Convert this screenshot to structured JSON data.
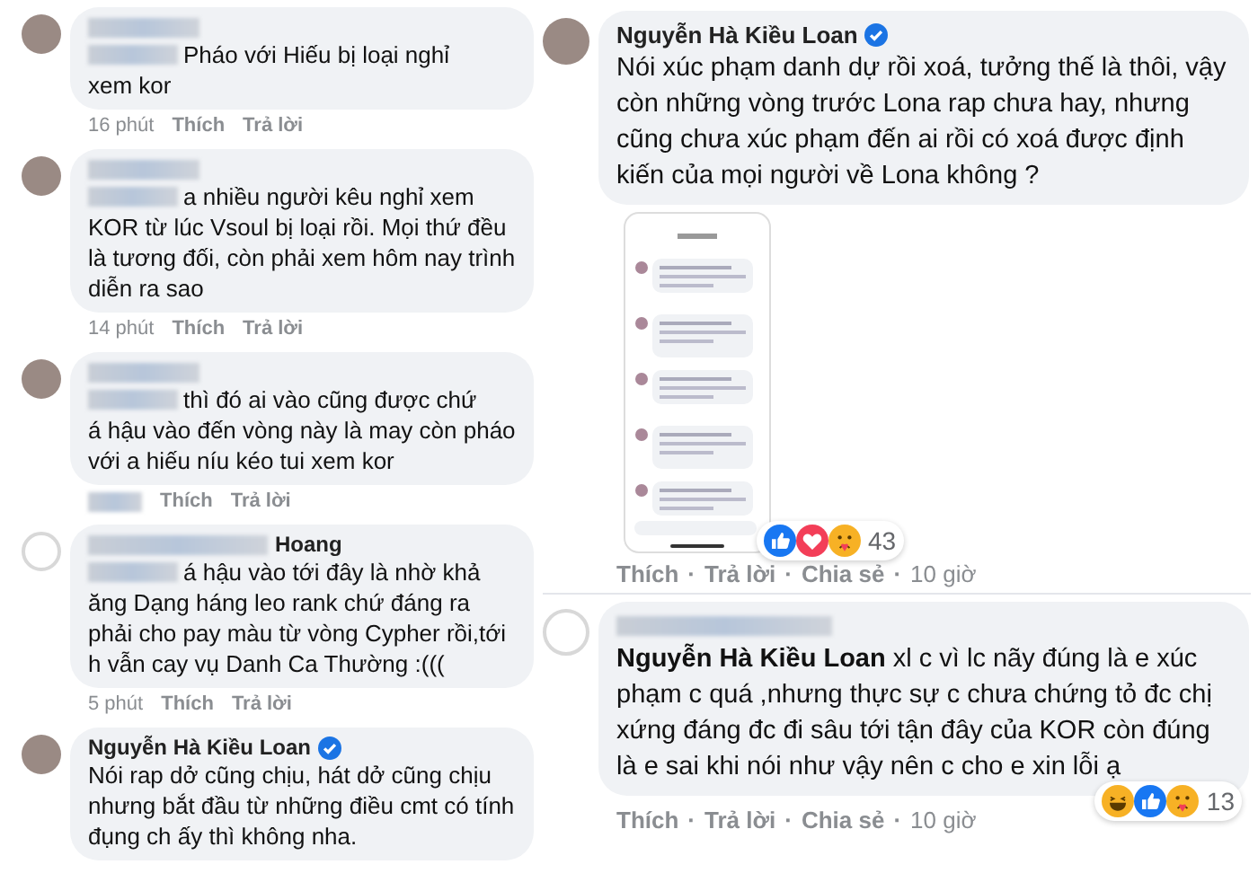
{
  "left_comments": [
    {
      "has_photo": true,
      "lead": "Pháo với Hiếu bị loại nghỉ",
      "text": "xem kor",
      "time": "16 phút",
      "actions": [
        "Thích",
        "Trả lời"
      ]
    },
    {
      "has_photo": true,
      "lead": "a nhiều người kêu nghỉ xem",
      "text": "KOR từ lúc Vsoul bị loại rồi. Mọi thứ đều là tương đối, còn phải xem hôm nay trình diễn ra sao",
      "time": "14 phút",
      "actions": [
        "Thích",
        "Trả lời"
      ]
    },
    {
      "has_photo": true,
      "lead": "thì đó ai vào cũng được chứ",
      "text": "á hậu vào đến vòng này là may còn pháo với a hiếu níu kéo tui xem kor",
      "actions": [
        "Thích",
        "Trả lời"
      ]
    },
    {
      "has_photo": false,
      "name": "Hoang",
      "lead": "á hậu vào tới đây là nhờ khả",
      "text": "ăng Dạng háng leo rank chứ đáng ra phải cho pay màu từ vòng Cypher rồi,tới h vẫn cay vụ Danh Ca Thường :(((",
      "time": "5 phút",
      "actions": [
        "Thích",
        "Trả lời"
      ]
    },
    {
      "has_photo": true,
      "name": "Nguyễn Hà Kiều Loan",
      "verified": true,
      "text": "Nói rap dở cũng chịu, hát dở cũng chịu nhưng bắt đầu từ những điều cmt có tính đụng ch ấy thì không nha."
    }
  ],
  "right_comments": [
    {
      "has_photo": true,
      "name": "Nguyễn Hà Kiều Loan",
      "verified": true,
      "text": "Nói xúc phạm danh dự rồi xoá, tưởng thế là thôi, vậy còn những vòng trước Lona rap chưa hay, nhưng cũng chưa xúc phạm đến ai rồi có xoá được định kiến của mọi người về Lona không ?",
      "has_screenshot": true,
      "reactions": [
        {
          "kind": "like"
        },
        {
          "kind": "love"
        },
        {
          "kind": "care"
        }
      ],
      "reaction_count": "43",
      "actions": [
        "Thích",
        "Trả lời",
        "Chia sẻ",
        "10 giờ"
      ]
    },
    {
      "has_photo": false,
      "text": "**Nguyễn Hà Kiều Loan** xl c vì lc nãy đúng là e xúc phạm c quá ,nhưng thực sự c chưa chứng tỏ đc chị xứng đáng đc đi sâu tới tận đây của KOR còn đúng là e sai khi nói như vậy nên c cho e xin lỗi ạ",
      "reactions": [
        {
          "kind": "haha"
        },
        {
          "kind": "like"
        },
        {
          "kind": "care"
        }
      ],
      "reaction_count": "13",
      "actions": [
        "Thích",
        "Trả lời",
        "Chia sẻ",
        "10 giờ"
      ]
    }
  ],
  "separator": "·"
}
